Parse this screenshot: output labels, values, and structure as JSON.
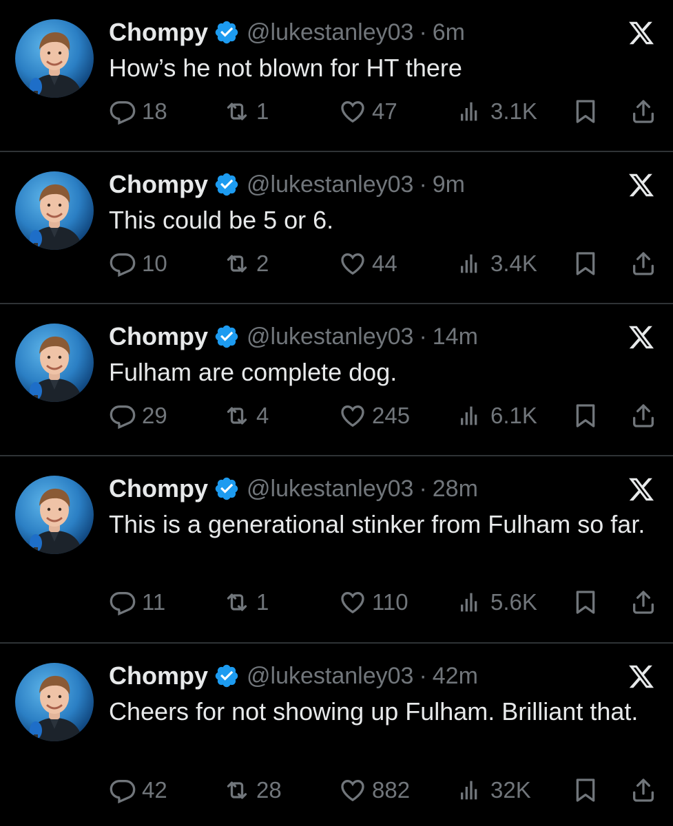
{
  "colors": {
    "background": "#000000",
    "text": "#e7e9ea",
    "muted": "#71767b",
    "verified": "#1d9bf0",
    "divider": "#2f3336"
  },
  "icons": [
    "avatar",
    "verified-badge-icon",
    "x-logo-icon",
    "reply-icon",
    "retweet-icon",
    "like-icon",
    "views-icon",
    "bookmark-icon",
    "share-icon"
  ],
  "tweets": [
    {
      "name": "Chompy",
      "handle": "@lukestanley03",
      "separator": "·",
      "time": "6m",
      "text": "How’s he not blown for HT there",
      "replies": "18",
      "retweets": "1",
      "likes": "47",
      "views": "3.1K"
    },
    {
      "name": "Chompy",
      "handle": "@lukestanley03",
      "separator": "·",
      "time": "9m",
      "text": "This could be 5 or 6.",
      "replies": "10",
      "retweets": "2",
      "likes": "44",
      "views": "3.4K"
    },
    {
      "name": "Chompy",
      "handle": "@lukestanley03",
      "separator": "·",
      "time": "14m",
      "text": "Fulham are complete dog.",
      "replies": "29",
      "retweets": "4",
      "likes": "245",
      "views": "6.1K"
    },
    {
      "name": "Chompy",
      "handle": "@lukestanley03",
      "separator": "·",
      "time": "28m",
      "text": "This is a generational stinker from Fulham so far.",
      "replies": "11",
      "retweets": "1",
      "likes": "110",
      "views": "5.6K"
    },
    {
      "name": "Chompy",
      "handle": "@lukestanley03",
      "separator": "·",
      "time": "42m",
      "text": "Cheers for not showing up Fulham. Brilliant that.",
      "replies": "42",
      "retweets": "28",
      "likes": "882",
      "views": "32K"
    }
  ]
}
